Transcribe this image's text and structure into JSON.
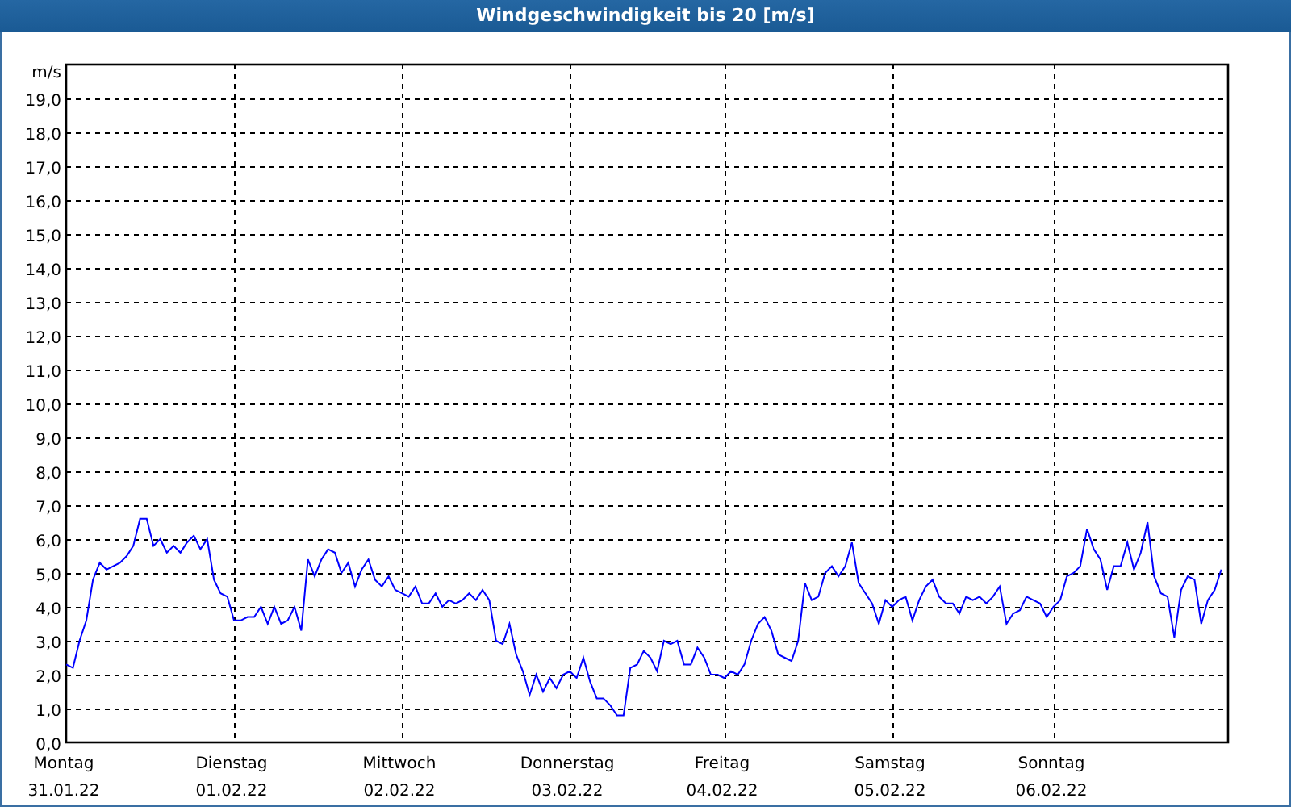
{
  "window": {
    "title": "Windgeschwindigkeit bis 20 [m/s]"
  },
  "chart": {
    "chart_data": {
      "type": "line",
      "ylabel": "m/s",
      "ylim": [
        0,
        20
      ],
      "grid": true,
      "yticks": [
        {
          "value": 0,
          "label": "0,0"
        },
        {
          "value": 1,
          "label": "1,0"
        },
        {
          "value": 2,
          "label": "2,0"
        },
        {
          "value": 3,
          "label": "3,0"
        },
        {
          "value": 4,
          "label": "4,0"
        },
        {
          "value": 5,
          "label": "5,0"
        },
        {
          "value": 6,
          "label": "6,0"
        },
        {
          "value": 7,
          "label": "7,0"
        },
        {
          "value": 8,
          "label": "8,0"
        },
        {
          "value": 9,
          "label": "9,0"
        },
        {
          "value": 10,
          "label": "10,0"
        },
        {
          "value": 11,
          "label": "11,0"
        },
        {
          "value": 12,
          "label": "12,0"
        },
        {
          "value": 13,
          "label": "13,0"
        },
        {
          "value": 14,
          "label": "14,0"
        },
        {
          "value": 15,
          "label": "15,0"
        },
        {
          "value": 16,
          "label": "16,0"
        },
        {
          "value": 17,
          "label": "17,0"
        },
        {
          "value": 18,
          "label": "18,0"
        },
        {
          "value": 19,
          "label": "19,0"
        }
      ],
      "categories": [
        "Montag\n31.01.22",
        null,
        null,
        null,
        null,
        null,
        null,
        null,
        null,
        null,
        null,
        null,
        null,
        null,
        null,
        null,
        null,
        null,
        null,
        null,
        null,
        null,
        null,
        null,
        null,
        "Dienstag\n01.02.22",
        null,
        null,
        null,
        null,
        null,
        null,
        null,
        null,
        null,
        null,
        null,
        null,
        null,
        null,
        null,
        null,
        null,
        null,
        null,
        null,
        null,
        null,
        null,
        null,
        "Mittwoch\n02.02.22",
        null,
        null,
        null,
        null,
        null,
        null,
        null,
        null,
        null,
        null,
        null,
        null,
        null,
        null,
        null,
        null,
        null,
        null,
        null,
        null,
        null,
        null,
        null,
        null,
        "Donnerstag\n03.02.22",
        null,
        null,
        null,
        null,
        null,
        null,
        null,
        null,
        null,
        null,
        null,
        null,
        null,
        null,
        null,
        null,
        null,
        null,
        null,
        null,
        null,
        null,
        "Freitag\n04.02.22",
        null,
        null,
        null,
        null,
        null,
        null,
        null,
        null,
        null,
        null,
        null,
        null,
        null,
        null,
        null,
        null,
        null,
        null,
        null,
        null,
        null,
        null,
        null,
        null,
        "Samstag\n05.02.22",
        null,
        null,
        null,
        null,
        null,
        null,
        null,
        null,
        null,
        null,
        null,
        null,
        null,
        null,
        null,
        null,
        null,
        null,
        null,
        null,
        null,
        null,
        null,
        "Sonntag\n06.02.22",
        null,
        null,
        null,
        null,
        null,
        null,
        null,
        null,
        null,
        null,
        null,
        null,
        null,
        null,
        null,
        null,
        null,
        null,
        null,
        null,
        null,
        null,
        null,
        null,
        null
      ],
      "series": [
        {
          "color": "#0000ff",
          "values": [
            2.3,
            2.2,
            3.0,
            3.6,
            4.8,
            5.3,
            5.1,
            5.2,
            5.3,
            5.5,
            5.8,
            6.6,
            6.6,
            5.8,
            6.0,
            5.6,
            5.8,
            5.6,
            5.9,
            6.1,
            5.7,
            6.0,
            4.8,
            4.4,
            4.3,
            3.6,
            3.6,
            3.7,
            3.7,
            4.0,
            3.5,
            4.0,
            3.5,
            3.6,
            4.0,
            3.3,
            5.4,
            4.9,
            5.4,
            5.7,
            5.6,
            5.0,
            5.3,
            4.6,
            5.1,
            5.4,
            4.8,
            4.6,
            4.9,
            4.5,
            4.4,
            4.3,
            4.6,
            4.1,
            4.1,
            4.4,
            4.0,
            4.2,
            4.1,
            4.2,
            4.4,
            4.2,
            4.5,
            4.2,
            3.0,
            2.9,
            3.5,
            2.6,
            2.1,
            1.4,
            2.0,
            1.5,
            1.9,
            1.6,
            2.0,
            2.1,
            1.9,
            2.5,
            1.8,
            1.3,
            1.3,
            1.1,
            0.8,
            0.8,
            2.2,
            2.3,
            2.7,
            2.5,
            2.1,
            3.0,
            2.9,
            3.0,
            2.3,
            2.3,
            2.8,
            2.5,
            2.0,
            2.0,
            1.9,
            2.1,
            2.0,
            2.3,
            3.0,
            3.5,
            3.7,
            3.3,
            2.6,
            2.5,
            2.4,
            3.0,
            4.7,
            4.2,
            4.3,
            5.0,
            5.2,
            4.9,
            5.2,
            5.9,
            4.7,
            4.4,
            4.1,
            3.5,
            4.2,
            4.0,
            4.2,
            4.3,
            3.6,
            4.2,
            4.6,
            4.8,
            4.3,
            4.1,
            4.1,
            3.8,
            4.3,
            4.2,
            4.3,
            4.1,
            4.3,
            4.6,
            3.5,
            3.8,
            3.9,
            4.3,
            4.2,
            4.1,
            3.7,
            4.0,
            4.2,
            4.9,
            5.0,
            5.2,
            6.3,
            5.7,
            5.4,
            4.5,
            5.2,
            5.2,
            5.9,
            5.1,
            5.6,
            6.5,
            4.9,
            4.4,
            4.3,
            3.1,
            4.5,
            4.9,
            4.8,
            3.5,
            4.2,
            4.5,
            5.1
          ]
        }
      ]
    }
  }
}
